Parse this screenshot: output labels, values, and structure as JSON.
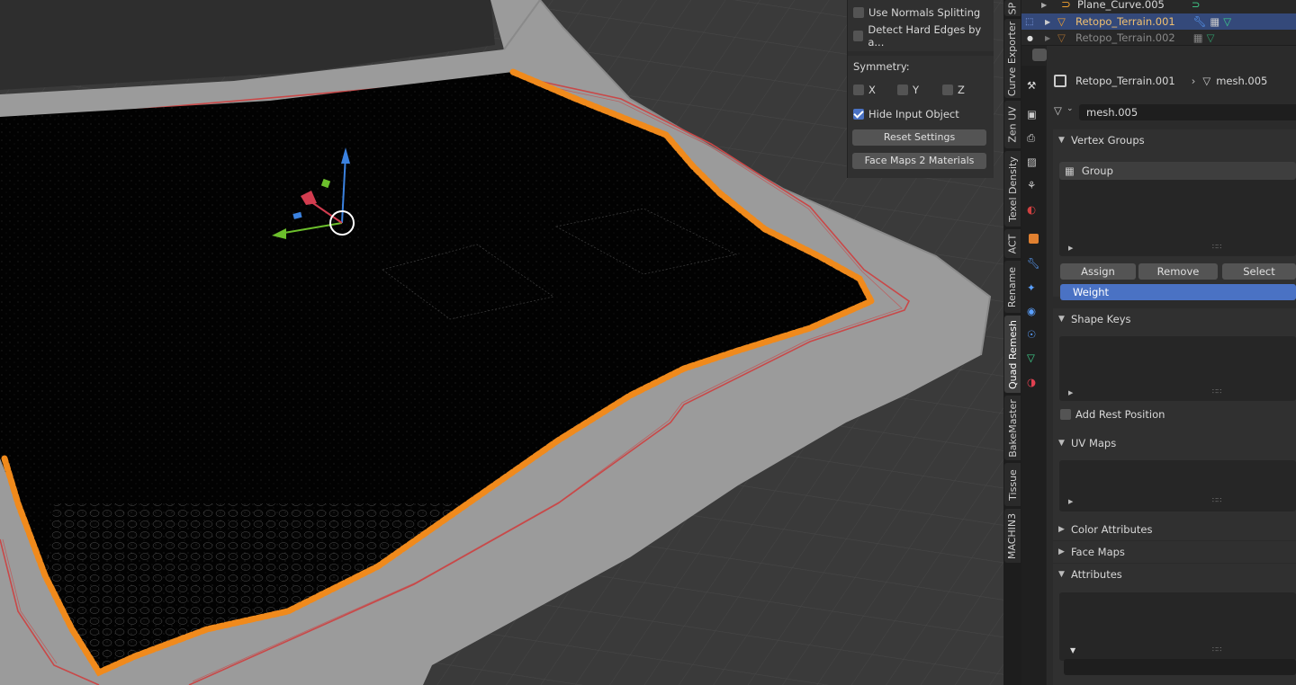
{
  "npanel": {
    "use_normals_splitting": "Use Normals Splitting",
    "detect_hard_edges": "Detect Hard Edges by a...",
    "symmetry_label": "Symmetry:",
    "sym_x": "X",
    "sym_y": "Y",
    "sym_z": "Z",
    "hide_input_object": "Hide Input Object",
    "reset_settings": "Reset Settings",
    "face_maps_2_materials": "Face Maps 2 Materials"
  },
  "vertical_tabs": [
    "SP",
    "Curve Exporter",
    "Zen UV",
    "Texel Density",
    "ACT",
    "Rename",
    "Quad Remesh",
    "BakeMaster",
    "Tissue",
    "MACHIN3"
  ],
  "outliner": {
    "items": [
      {
        "name": "Plane_Curve.005"
      },
      {
        "name": "Retopo_Terrain.001"
      },
      {
        "name": "Retopo_Terrain.002"
      }
    ]
  },
  "properties": {
    "breadcrumb_object": "Retopo_Terrain.001",
    "breadcrumb_mesh": "mesh.005",
    "mesh_name": "mesh.005",
    "vertex_groups_title": "Vertex Groups",
    "vertex_group_item": "Group",
    "assign": "Assign",
    "remove": "Remove",
    "select": "Select",
    "weight": "Weight",
    "shape_keys_title": "Shape Keys",
    "add_rest_position": "Add Rest Position",
    "uv_maps_title": "UV Maps",
    "color_attributes_title": "Color Attributes",
    "face_maps_title": "Face Maps",
    "attributes_title": "Attributes"
  },
  "colors": {
    "selection_orange": "#f08a1c",
    "active_blue": "#4a72c4",
    "outliner_selected": "#34497a",
    "mesh_icon_green": "#3fd08c"
  }
}
